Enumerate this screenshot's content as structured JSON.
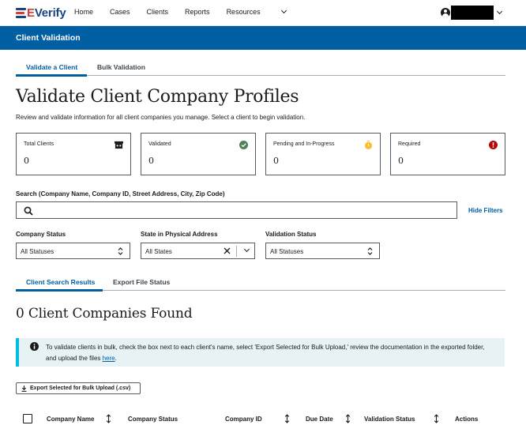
{
  "brand": {
    "logo_letter": "E",
    "logo_rest": "Verify",
    "primary": "#005ea2",
    "accent_red": "#d83933"
  },
  "nav": {
    "items": [
      "Home",
      "Cases",
      "Clients",
      "Reports",
      "Resources"
    ]
  },
  "user": {
    "icon": "user-circle-icon",
    "name_redacted": true
  },
  "banner": {
    "title": "Client Validation"
  },
  "top_tabs": [
    {
      "label": "Validate a Client",
      "active": true
    },
    {
      "label": "Bulk Validation",
      "active": false
    }
  ],
  "page": {
    "title": "Validate Client Company Profiles",
    "subtitle": "Review and validate information for all client companies you manage. Select a client to begin validation."
  },
  "cards": [
    {
      "label": "Total Clients",
      "value": "0",
      "icon": "building-icon"
    },
    {
      "label": "Validated",
      "value": "0",
      "icon": "check-circle-icon",
      "color": "#4d8055"
    },
    {
      "label": "Pending and In-Progress",
      "value": "0",
      "icon": "clock-icon",
      "color": "#ffbe2e"
    },
    {
      "label": "Required",
      "value": "0",
      "icon": "error-icon",
      "color": "#b50909"
    }
  ],
  "search": {
    "label": "Search (Company Name, Company ID, Street Address, City, Zip Code)",
    "value": "",
    "hide_filters": "Hide Filters"
  },
  "filters": {
    "company_status": {
      "label": "Company Status",
      "value": "All Statuses"
    },
    "state": {
      "label": "State in Physical Address",
      "value": "All States"
    },
    "validation_status": {
      "label": "Validation Status",
      "value": "All Statuses"
    }
  },
  "result_tabs": [
    {
      "label": "Client Search Results",
      "active": true
    },
    {
      "label": "Export File Status",
      "active": false
    }
  ],
  "results": {
    "heading": "0 Client Companies Found"
  },
  "alert": {
    "text": "To validate clients in bulk, check the box next to each client's name, select 'Export Selected for Bulk Upload,' review the documentation in the exported folder, and upload the files ",
    "link": "here",
    "end": "."
  },
  "export_button": {
    "label": "Export Selected for Bulk Upload (.csv)"
  },
  "table": {
    "columns": [
      "Company Name",
      "Company Status",
      "Company ID",
      "Due Date",
      "Validation Status",
      "Actions"
    ]
  }
}
